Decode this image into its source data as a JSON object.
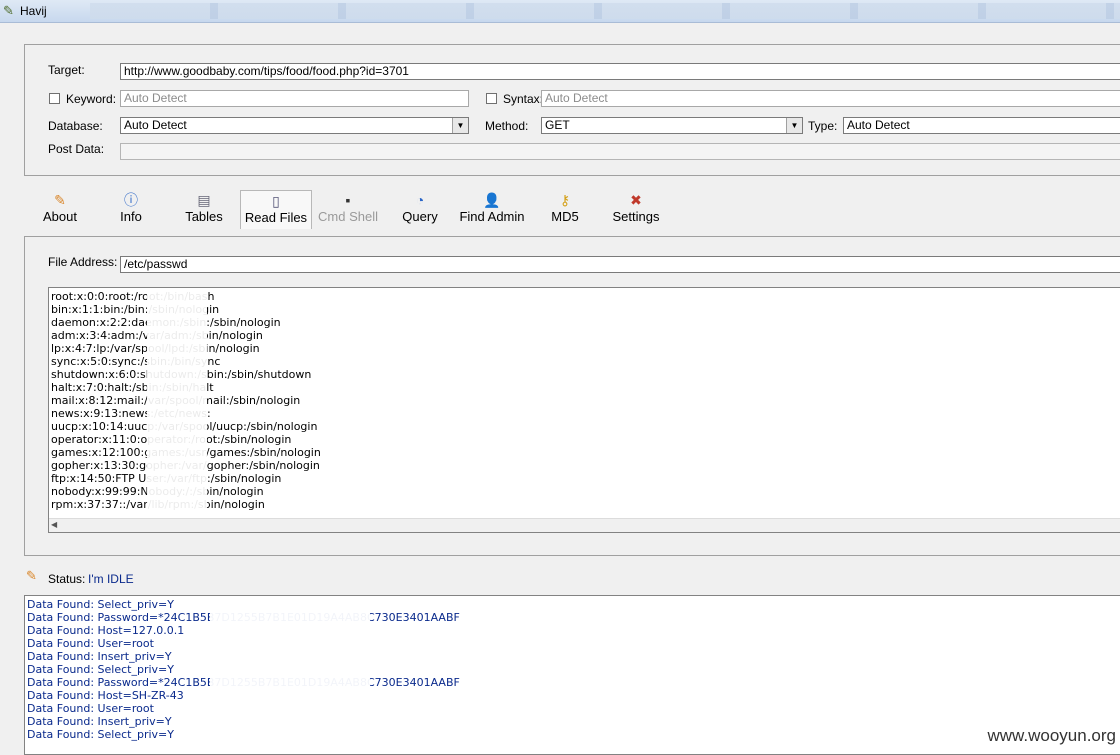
{
  "window": {
    "title": "Havij"
  },
  "target": {
    "label": "Target:",
    "value": "http://www.goodbaby.com/tips/food/food.php?id=3701"
  },
  "keyword": {
    "label": "Keyword:",
    "placeholder": "Auto Detect"
  },
  "syntax": {
    "label": "Syntax:",
    "placeholder": "Auto Detect"
  },
  "database": {
    "label": "Database:",
    "value": "Auto Detect"
  },
  "method": {
    "label": "Method:",
    "value": "GET"
  },
  "type": {
    "label": "Type:",
    "value": "Auto Detect"
  },
  "post_data": {
    "label": "Post Data:"
  },
  "toolbar": {
    "about": "About",
    "info": "Info",
    "tables": "Tables",
    "read_files": "Read Files",
    "cmd_shell": "Cmd Shell",
    "query": "Query",
    "find_admin": "Find Admin",
    "md5": "MD5",
    "settings": "Settings"
  },
  "file_address": {
    "label": "File Address:",
    "value": "/etc/passwd"
  },
  "file_content": [
    "root:x:0:0:root:/root:/bin/bash",
    "bin:x:1:1:bin:/bin:/sbin/nologin",
    "daemon:x:2:2:daemon:/sbin:/sbin/nologin",
    "adm:x:3:4:adm:/var/adm:/sbin/nologin",
    "lp:x:4:7:lp:/var/spool/lpd:/sbin/nologin",
    "sync:x:5:0:sync:/sbin:/bin/sync",
    "shutdown:x:6:0:shutdown:/sbin:/sbin/shutdown",
    "halt:x:7:0:halt:/sbin:/sbin/halt",
    "mail:x:8:12:mail:/var/spool/mail:/sbin/nologin",
    "news:x:9:13:news:/etc/news:",
    "uucp:x:10:14:uucp:/var/spool/uucp:/sbin/nologin",
    "operator:x:11:0:operator:/root:/sbin/nologin",
    "games:x:12:100:games:/usr/games:/sbin/nologin",
    "gopher:x:13:30:gopher:/var/gopher:/sbin/nologin",
    "ftp:x:14:50:FTP User:/var/ftp:/sbin/nologin",
    "nobody:x:99:99:Nobody:/:/sbin/nologin",
    "rpm:x:37:37::/var/lib/rpm:/sbin/nologin"
  ],
  "status": {
    "label": "Status:",
    "value": "I'm IDLE"
  },
  "log": [
    "Data Found: Select_priv=Y",
    "Data Found: Password=*24C1B5B7D1255B7B1E01D19A4AB8C730E3401AABF",
    "Data Found: Host=127.0.0.1",
    "Data Found: User=root",
    "Data Found: Insert_priv=Y",
    "Data Found: Select_priv=Y",
    "Data Found: Password=*24C1B5B7D1255B7B1E01D19A4AB8C730E3401AABF",
    "Data Found: Host=SH-ZR-43",
    "Data Found: User=root",
    "Data Found: Insert_priv=Y",
    "Data Found: Select_priv=Y"
  ],
  "watermark": "www.wooyun.org",
  "icons": {
    "app": "carrot-icon",
    "about": "carrot-icon",
    "info": "info-circle-icon",
    "tables": "table-icon",
    "read_files": "document-icon",
    "cmd_shell": "terminal-icon",
    "query": "query-icon",
    "find_admin": "users-icon",
    "md5": "key-icon",
    "settings": "tools-icon",
    "status": "carrot-icon"
  }
}
